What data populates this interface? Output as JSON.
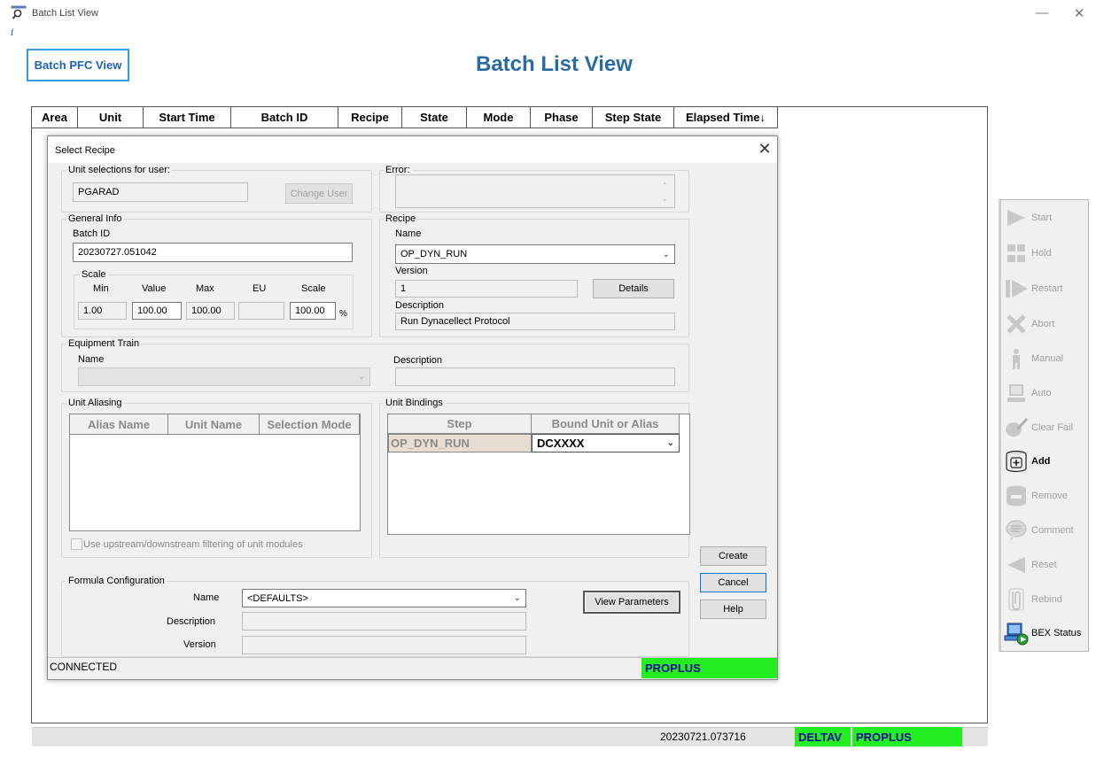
{
  "window": {
    "title": "Batch List View"
  },
  "info_mark": "i",
  "pfc_button": "Batch PFC View",
  "page_title": "Batch List View",
  "columns": [
    "Area",
    "Unit",
    "Start Time",
    "Batch ID",
    "Recipe",
    "State",
    "Mode",
    "Phase",
    "Step State",
    "Elapsed Time↓"
  ],
  "dialog": {
    "title": "Select Recipe",
    "unit_selections": {
      "label": "Unit selections for user:",
      "value": "PGARAD",
      "change_user": "Change User"
    },
    "error": {
      "label": "Error:",
      "value": ""
    },
    "general_info": {
      "label": "General Info",
      "batch_id_label": "Batch ID",
      "batch_id": "20230727.051042",
      "scale": {
        "label": "Scale",
        "min_label": "Min",
        "value_label": "Value",
        "max_label": "Max",
        "eu_label": "EU",
        "scale_label": "Scale",
        "min": "1.00",
        "value": "100.00",
        "max": "100.00",
        "eu": "",
        "scale": "100.00",
        "percent": "%"
      }
    },
    "recipe": {
      "label": "Recipe",
      "name_label": "Name",
      "name": "OP_DYN_RUN",
      "version_label": "Version",
      "version": "1",
      "details": "Details",
      "description_label": "Description",
      "description": "Run Dynacellect Protocol"
    },
    "equipment_train": {
      "label": "Equipment Train",
      "name_label": "Name",
      "name": "",
      "description_label": "Description",
      "description": ""
    },
    "unit_aliasing": {
      "label": "Unit Aliasing",
      "columns": [
        "Alias Name",
        "Unit Name",
        "Selection Mode"
      ],
      "filter_checkbox": "Use upstream/downstream filtering of unit modules"
    },
    "unit_bindings": {
      "label": "Unit Bindings",
      "columns": [
        "Step",
        "Bound Unit or Alias"
      ],
      "rows": [
        {
          "step": "OP_DYN_RUN",
          "bound": "DCXXXX"
        }
      ]
    },
    "buttons": {
      "create": "Create",
      "cancel": "Cancel",
      "help": "Help"
    },
    "formula": {
      "label": "Formula Configuration",
      "name_label": "Name",
      "name": "<DEFAULTS>",
      "description_label": "Description",
      "description": "",
      "version_label": "Version",
      "version": "",
      "view_parameters": "View Parameters"
    },
    "status": {
      "connection": "CONNECTED",
      "node": "PROPLUS"
    }
  },
  "status_bar": {
    "batch": "20230721.073716",
    "system": "DELTAV",
    "node": "PROPLUS"
  },
  "toolbar": [
    {
      "label": "Start",
      "icon": "play-icon",
      "enabled": false
    },
    {
      "label": "Hold",
      "icon": "hold-icon",
      "enabled": false
    },
    {
      "label": "Restart",
      "icon": "restart-icon",
      "enabled": false
    },
    {
      "label": "Abort",
      "icon": "abort-x-icon",
      "enabled": false
    },
    {
      "label": "Manual",
      "icon": "person-icon",
      "enabled": false
    },
    {
      "label": "Auto",
      "icon": "computer-icon",
      "enabled": false
    },
    {
      "label": "Clear Fail",
      "icon": "clear-fail-icon",
      "enabled": false
    },
    {
      "label": "Add",
      "icon": "add-barrel-icon",
      "enabled": true
    },
    {
      "label": "Remove",
      "icon": "remove-barrel-icon",
      "enabled": false
    },
    {
      "label": "Comment",
      "icon": "comment-icon",
      "enabled": false
    },
    {
      "label": "Reset",
      "icon": "reset-icon",
      "enabled": false
    },
    {
      "label": "Rebind",
      "icon": "rebind-icon",
      "enabled": false
    },
    {
      "label": "BEX Status",
      "icon": "bex-status-icon",
      "enabled": true
    }
  ]
}
